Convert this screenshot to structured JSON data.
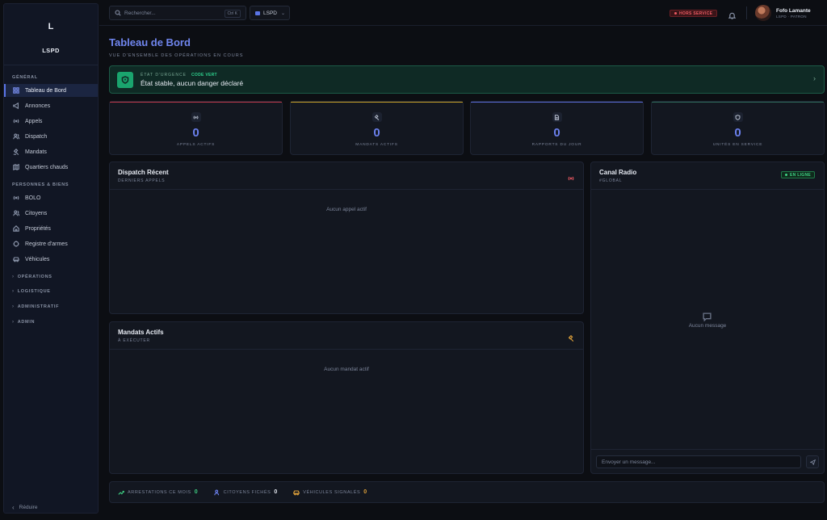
{
  "sidebar": {
    "logo_letter": "L",
    "logo_name": "LSPD",
    "sections": {
      "general": "GÉNÉRAL",
      "persons": "PERSONNES & BIENS"
    },
    "general_items": [
      {
        "label": "Tableau de Bord",
        "icon": "grid-icon",
        "active": true
      },
      {
        "label": "Annonces",
        "icon": "megaphone-icon"
      },
      {
        "label": "Appels",
        "icon": "radio-icon"
      },
      {
        "label": "Dispatch",
        "icon": "users-icon"
      },
      {
        "label": "Mandats",
        "icon": "gavel-icon"
      },
      {
        "label": "Quartiers chauds",
        "icon": "map-icon"
      }
    ],
    "person_items": [
      {
        "label": "BOLO",
        "icon": "radio-icon"
      },
      {
        "label": "Citoyens",
        "icon": "users-icon"
      },
      {
        "label": "Propriétés",
        "icon": "home-icon"
      },
      {
        "label": "Registre d'armes",
        "icon": "target-icon"
      },
      {
        "label": "Véhicules",
        "icon": "car-icon"
      }
    ],
    "collapsed": [
      "OPÉRATIONS",
      "LOGISTIQUE",
      "ADMINISTRATIF",
      "ADMIN"
    ],
    "reduce_label": "Réduire"
  },
  "topbar": {
    "search_placeholder": "Rechercher...",
    "search_shortcut": "Ctrl K",
    "agency": "LSPD",
    "status": "HORS SERVICE",
    "user_name": "Fofo Lamante",
    "user_role": "LSPD · PATRON"
  },
  "main": {
    "title": "Tableau de Bord",
    "subtitle": "VUE D'ENSEMBLE DES OPÉRATIONS EN COURS",
    "alert": {
      "label": "ÉTAT D'URGENCE",
      "code": "CODE VERT",
      "text": "État stable, aucun danger déclaré"
    },
    "stats": [
      {
        "value": "0",
        "label": "APPELS ACTIFS",
        "color": "#c0394a",
        "icon": "radio-icon"
      },
      {
        "value": "0",
        "label": "MANDATS ACTIFS",
        "color": "#c9a227",
        "icon": "gavel-icon"
      },
      {
        "value": "0",
        "label": "RAPPORTS DU JOUR",
        "color": "#5a6ad6",
        "icon": "document-icon"
      },
      {
        "value": "0",
        "label": "UNITÉS EN SERVICE",
        "color": "#2e6b5a",
        "icon": "shield-icon"
      }
    ],
    "dispatch": {
      "title": "Dispatch Récent",
      "subtitle": "DERNIERS APPELS",
      "empty": "Aucun appel actif"
    },
    "warrants": {
      "title": "Mandats Actifs",
      "subtitle": "À EXÉCUTER",
      "empty": "Aucun mandat actif"
    },
    "radio": {
      "title": "Canal Radio",
      "subtitle": "#GLOBAL",
      "status": "EN LIGNE",
      "empty": "Aucun message",
      "input_placeholder": "Envoyer un message..."
    },
    "footer_stats": [
      {
        "label": "ARRESTATIONS CE MOIS",
        "value": "0",
        "color": "#3fd184",
        "icon": "trend-up-icon"
      },
      {
        "label": "CITOYENS FICHÉS",
        "value": "0",
        "color": "#6b80ec",
        "icon": "users-icon"
      },
      {
        "label": "VÉHICULES SIGNALÉS",
        "value": "0",
        "color": "#e0a23a",
        "icon": "car-icon"
      }
    ]
  }
}
